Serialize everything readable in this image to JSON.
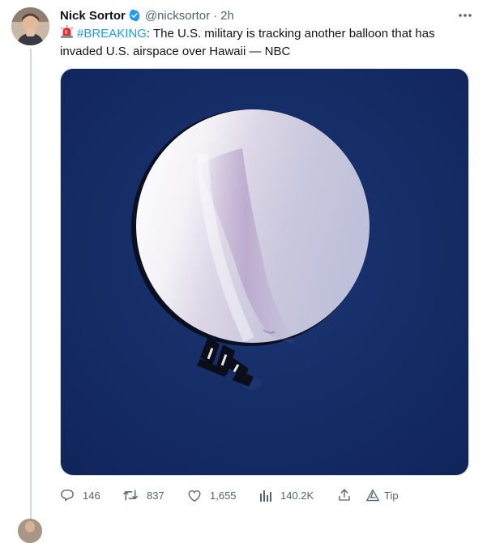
{
  "tweet": {
    "author_name": "Nick Sortor",
    "author_handle": "@nicksortor",
    "separator": "·",
    "time": "2h",
    "text_prefix_icon": "police-siren-emoji",
    "hashtag": "#BREAKING",
    "body": ": The U.S. military is tracking another balloon that has invaded U.S. airspace over Hawaii — NBC",
    "media_description_icon": "balloon-photo"
  },
  "actions": {
    "replies": "146",
    "retweets": "837",
    "likes": "1,655",
    "views": "140.2K",
    "tip_label": "Tip"
  },
  "colors": {
    "accent": "#1d9bf0",
    "secondary_text": "#536471",
    "thread_line": "#cfd9de",
    "photo_sky": "#13285a"
  }
}
